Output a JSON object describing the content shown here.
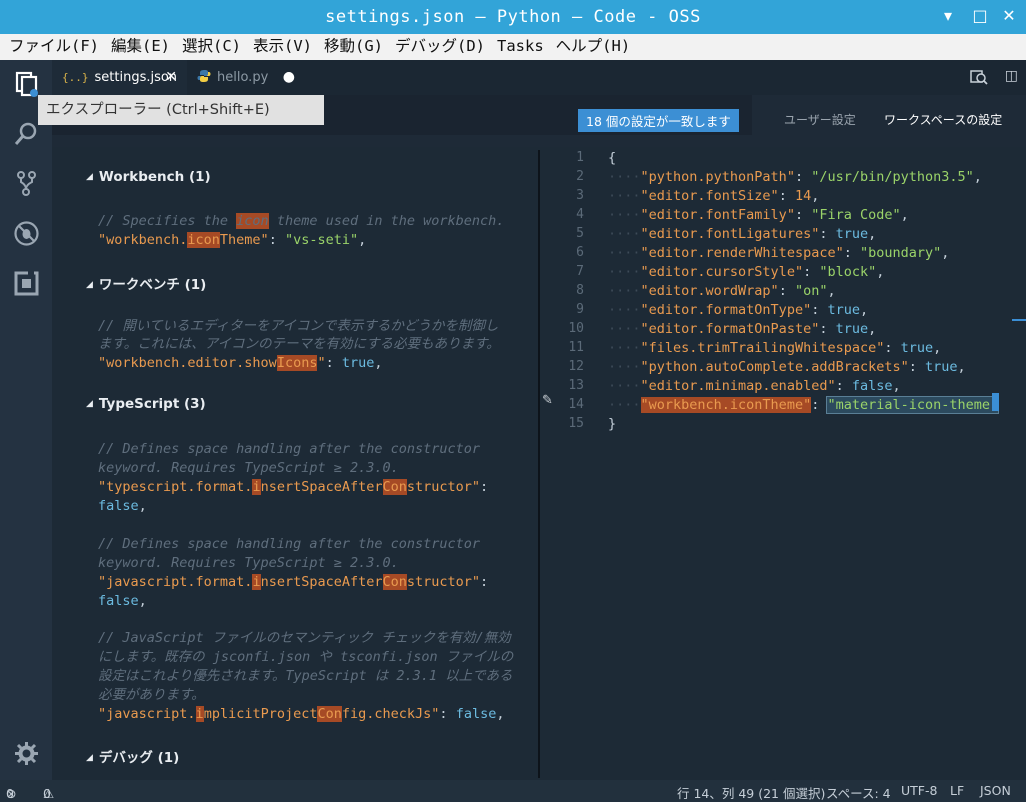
{
  "window": {
    "title": "settings.json — Python — Code - OSS"
  },
  "menu": [
    "ファイル(F)",
    "編集(E)",
    "選択(C)",
    "表示(V)",
    "移動(G)",
    "デバッグ(D)",
    "Tasks",
    "ヘルプ(H)"
  ],
  "tooltip": "エクスプローラー (Ctrl+Shift+E)",
  "tabs": [
    {
      "label": "settings.json",
      "icon": "{..}",
      "close": "✕"
    },
    {
      "label": "hello.py",
      "icon": "python-icon",
      "dirty": "●"
    }
  ],
  "settings_header": {
    "match_badge": "18 個の設定が一致します",
    "user_tab": "ユーザー設定",
    "workspace_tab": "ワークスペースの設定"
  },
  "left_sections": {
    "workbench": "Workbench (1)",
    "workbench_ja": "ワークベンチ (1)",
    "typescript": "TypeScript (3)",
    "debug": "デバッグ (1)"
  },
  "left_code": {
    "wb_c1": "// Specifies the ",
    "wb_c2": "icon",
    "wb_c3": " theme used in the workbench.",
    "wb_k1": "\"workbench.",
    "wb_k2": "icon",
    "wb_k3": "Theme\"",
    "wb_v": "\"vs-seti\"",
    "ja_c1": "// 開いているエディターをアイコンで表示するかどうかを制御し",
    "ja_c2": "ます。これには、アイコンのテーマを有効にする必要もあります。",
    "ja_k1": "\"workbench.editor.show",
    "ja_k2": "Icons",
    "ja_k3": "\"",
    "ja_v": "true",
    "ts1_c1": "// Defines space handling after the constructor",
    "ts1_c2": "keyword. Requires TypeScript ≥ 2.3.0.",
    "ts1_k1": "\"typescript.format.",
    "ts1_k2": "i",
    "ts1_k3": "nsertSpaceAfter",
    "ts1_k4": "Con",
    "ts1_k5": "structor\"",
    "ts1_v": "false",
    "ts2_c1": "// Defines space handling after the constructor",
    "ts2_c2": "keyword. Requires TypeScript ≥ 2.3.0.",
    "ts2_k1": "\"javascript.format.",
    "ts2_k2": "i",
    "ts2_k3": "nsertSpaceAfter",
    "ts2_k4": "Con",
    "ts2_k5": "structor\"",
    "ts2_v": "false",
    "ts3_c1": "// JavaScript ファイルのセマンティック チェックを有効/無効",
    "ts3_c2": "にします。既存の jsconfi.json や tsconfi.json ファイルの",
    "ts3_c3": "設定はこれより優先されます。TypeScript は 2.3.1 以上である",
    "ts3_c4": "必要があります。",
    "ts3_k1": "\"javascript.",
    "ts3_k2": "i",
    "ts3_k3": "mplicitProject",
    "ts3_k4": "Con",
    "ts3_k5": "fig.checkJs\"",
    "ts3_v": "false"
  },
  "editor_lines": [
    {
      "n": "1",
      "key": "",
      "val": ""
    },
    {
      "n": "2",
      "key": "\"python.pythonPath\"",
      "val": "\"/usr/bin/python3.5\""
    },
    {
      "n": "3",
      "key": "\"editor.fontSize\"",
      "val": "14"
    },
    {
      "n": "4",
      "key": "\"editor.fontFamily\"",
      "val": "\"Fira Code\""
    },
    {
      "n": "5",
      "key": "\"editor.fontLigatures\"",
      "val": "true"
    },
    {
      "n": "6",
      "key": "\"editor.renderWhitespace\"",
      "val": "\"boundary\""
    },
    {
      "n": "7",
      "key": "\"editor.cursorStyle\"",
      "val": "\"block\""
    },
    {
      "n": "8",
      "key": "\"editor.wordWrap\"",
      "val": "\"on\""
    },
    {
      "n": "9",
      "key": "\"editor.formatOnType\"",
      "val": "true"
    },
    {
      "n": "10",
      "key": "\"editor.formatOnPaste\"",
      "val": "true"
    },
    {
      "n": "11",
      "key": "\"files.trimTrailingWhitespace\"",
      "val": "true"
    },
    {
      "n": "12",
      "key": "\"python.autoComplete.addBrackets\"",
      "val": "true"
    },
    {
      "n": "13",
      "key": "\"editor.minimap.enabled\"",
      "val": "false"
    },
    {
      "n": "14",
      "key": "\"workbench.iconTheme\"",
      "val": "\"material-icon-theme\""
    },
    {
      "n": "15",
      "key": "",
      "val": ""
    }
  ],
  "status": {
    "errors": "0",
    "warnings": "0",
    "position": "行 14、列 49 (21 個選択)",
    "spaces": "スペース: 4",
    "encoding": "UTF-8",
    "eol": "LF",
    "language": "JSON"
  },
  "colors": {
    "titlebar": "#32a4d8",
    "accent": "#3c8fd4",
    "highlight": "#a64a25",
    "string": "#e99a4f",
    "value": "#9ad369",
    "keyword": "#6cbbe0"
  }
}
